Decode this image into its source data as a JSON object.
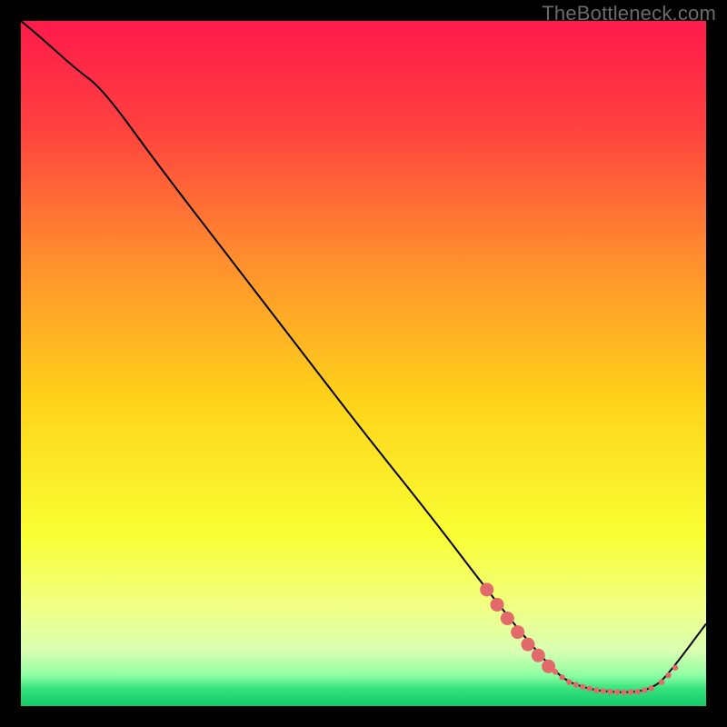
{
  "watermark": "TheBottleneck.com",
  "chart_data": {
    "type": "line",
    "title": "",
    "xlabel": "",
    "ylabel": "",
    "xlim": [
      0,
      100
    ],
    "ylim": [
      0,
      100
    ],
    "grid": false,
    "legend": false,
    "background_gradient_stops": [
      {
        "offset": 0.0,
        "color": "#ff1a4b"
      },
      {
        "offset": 0.15,
        "color": "#ff3f3f"
      },
      {
        "offset": 0.35,
        "color": "#ff8f2e"
      },
      {
        "offset": 0.55,
        "color": "#ffd21a"
      },
      {
        "offset": 0.75,
        "color": "#f9ff33"
      },
      {
        "offset": 0.85,
        "color": "#f2ff80"
      },
      {
        "offset": 0.92,
        "color": "#d9ffb3"
      },
      {
        "offset": 0.955,
        "color": "#8effa3"
      },
      {
        "offset": 0.975,
        "color": "#35e27d"
      },
      {
        "offset": 1.0,
        "color": "#12c96a"
      }
    ],
    "series": [
      {
        "name": "bottleneck-curve",
        "color": "#000000",
        "x": [
          0,
          3,
          8,
          12,
          20,
          30,
          40,
          50,
          60,
          68,
          74,
          78,
          80,
          82,
          84,
          86,
          88,
          90,
          92,
          94,
          100
        ],
        "y": [
          100,
          97.5,
          93,
          90,
          79,
          66,
          53,
          40,
          27.5,
          17,
          9.5,
          5,
          3.5,
          2.8,
          2.3,
          2.1,
          2.0,
          2.1,
          2.6,
          4.0,
          12
        ]
      }
    ],
    "marker_points": {
      "name": "highlight-dots",
      "color": "#e36a6a",
      "radius_small": 3.2,
      "radius_large": 7.5,
      "points": [
        {
          "x": 68.0,
          "y": 17.0,
          "r": "large"
        },
        {
          "x": 69.5,
          "y": 14.8,
          "r": "large"
        },
        {
          "x": 71.0,
          "y": 12.8,
          "r": "large"
        },
        {
          "x": 72.5,
          "y": 10.8,
          "r": "large"
        },
        {
          "x": 74.0,
          "y": 9.0,
          "r": "large"
        },
        {
          "x": 75.5,
          "y": 7.4,
          "r": "large"
        },
        {
          "x": 77.0,
          "y": 5.8,
          "r": "large"
        },
        {
          "x": 78.0,
          "y": 5.0,
          "r": "small"
        },
        {
          "x": 79.0,
          "y": 4.2,
          "r": "small"
        },
        {
          "x": 80.0,
          "y": 3.5,
          "r": "small"
        },
        {
          "x": 81.0,
          "y": 3.1,
          "r": "small"
        },
        {
          "x": 82.0,
          "y": 2.8,
          "r": "small"
        },
        {
          "x": 83.0,
          "y": 2.55,
          "r": "small"
        },
        {
          "x": 84.0,
          "y": 2.3,
          "r": "small"
        },
        {
          "x": 85.0,
          "y": 2.2,
          "r": "small"
        },
        {
          "x": 86.0,
          "y": 2.1,
          "r": "small"
        },
        {
          "x": 87.0,
          "y": 2.05,
          "r": "small"
        },
        {
          "x": 88.0,
          "y": 2.0,
          "r": "small"
        },
        {
          "x": 89.0,
          "y": 2.05,
          "r": "small"
        },
        {
          "x": 90.0,
          "y": 2.1,
          "r": "small"
        },
        {
          "x": 91.0,
          "y": 2.3,
          "r": "small"
        },
        {
          "x": 92.0,
          "y": 2.6,
          "r": "small"
        },
        {
          "x": 93.5,
          "y": 3.5,
          "r": "small"
        },
        {
          "x": 94.5,
          "y": 4.5,
          "r": "small"
        },
        {
          "x": 95.5,
          "y": 5.6,
          "r": "small"
        }
      ]
    }
  }
}
